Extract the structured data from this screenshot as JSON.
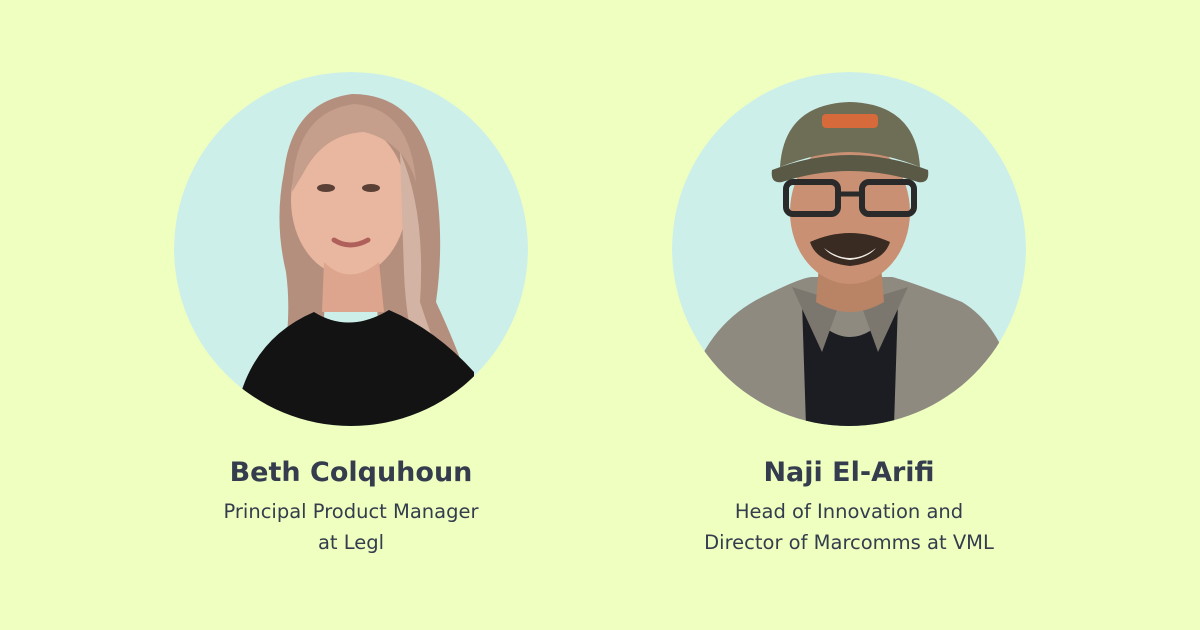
{
  "theme": {
    "background": "#EFFFBF",
    "circle": "#CDEFEA",
    "text": "#343C4E"
  },
  "speakers": [
    {
      "name": "Beth Colquhoun",
      "role_lines": [
        "Principal Product Manager",
        "at Legl"
      ],
      "photo_icon": "portrait-photo"
    },
    {
      "name": "Naji El-Arifi",
      "role_lines": [
        "Head of Innovation and",
        "Director of Marcomms at VML"
      ],
      "photo_icon": "portrait-photo"
    }
  ]
}
